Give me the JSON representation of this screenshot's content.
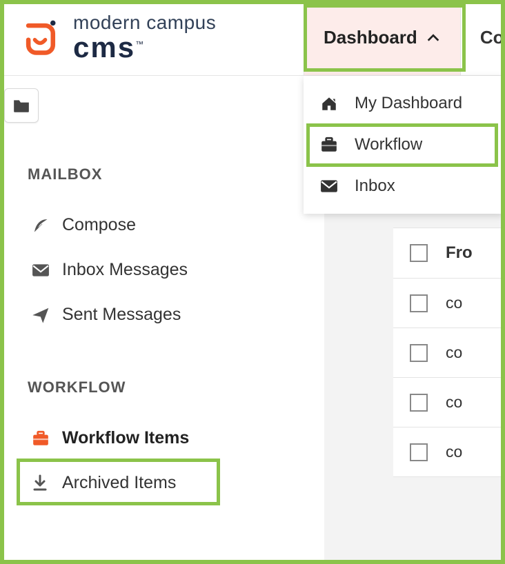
{
  "brand": {
    "top": "modern campus",
    "bottom": "cms",
    "tm": "™"
  },
  "nav": {
    "dashboard": "Dashboard",
    "content": "Co"
  },
  "dropdown": {
    "items": [
      {
        "label": "My Dashboard"
      },
      {
        "label": "Workflow"
      },
      {
        "label": "Inbox"
      }
    ]
  },
  "sidebar": {
    "mailbox_title": "MAILBOX",
    "workflow_title": "WORKFLOW",
    "mailbox": [
      {
        "label": "Compose"
      },
      {
        "label": "Inbox Messages"
      },
      {
        "label": "Sent Messages"
      }
    ],
    "workflow": [
      {
        "label": "Workflow Items"
      },
      {
        "label": "Archived Items"
      }
    ]
  },
  "table": {
    "header": "Fro",
    "rows": [
      {
        "text": "co"
      },
      {
        "text": "co"
      },
      {
        "text": "co"
      },
      {
        "text": "co"
      }
    ]
  }
}
